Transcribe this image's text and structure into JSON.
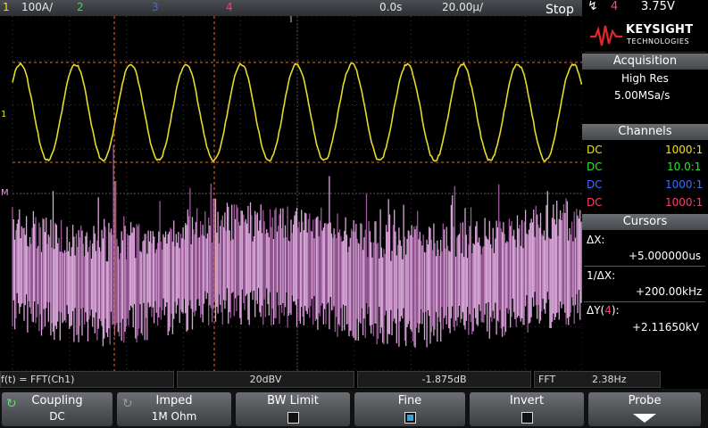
{
  "top_bar": {
    "ch1_scale": "100A/",
    "ch2": "2",
    "ch3": "3",
    "ch4": "4",
    "time_pos": "0.0s",
    "time_scale": "20.00µ/",
    "run_state": "Stop",
    "trigger_channel": "4",
    "trigger_level": "3.75V"
  },
  "brand": {
    "name": "KEYSIGHT",
    "sub": "TECHNOLOGIES"
  },
  "acquisition": {
    "header": "Acquisition",
    "mode": "High Res",
    "rate": "5.00MSa/s"
  },
  "channels": {
    "header": "Channels",
    "items": [
      {
        "coupling": "DC",
        "probe": "1000:1",
        "color": "#f0e400"
      },
      {
        "coupling": "DC",
        "probe": "10.0:1",
        "color": "#34e034"
      },
      {
        "coupling": "DC",
        "probe": "1000:1",
        "color": "#3b6cff"
      },
      {
        "coupling": "DC",
        "probe": "1000:1",
        "color": "#ff3c6e"
      }
    ]
  },
  "cursors": {
    "header": "Cursors",
    "dx_label": "ΔX:",
    "dx_value": "+5.000000us",
    "inv_dx_label": "1/ΔX:",
    "inv_dx_value": "+200.00kHz",
    "dy_label_pre": "ΔY(",
    "dy_ch": "4",
    "dy_label_post": "):",
    "dy_value": "+2.11650kV"
  },
  "status_bar": {
    "math": "f(t) = FFT(Ch1)",
    "vscale": "20dBV",
    "offset": "-1.875dB",
    "fft_label": "FFT",
    "fft_res": "2.38Hz"
  },
  "softkeys": {
    "coupling": {
      "label": "Coupling",
      "value": "DC"
    },
    "imped": {
      "label": "Imped",
      "value": "1M Ohm"
    },
    "bw_limit": {
      "label": "BW Limit",
      "checked": false
    },
    "fine": {
      "label": "Fine",
      "checked": true
    },
    "invert": {
      "label": "Invert",
      "checked": false
    },
    "probe": {
      "label": "Probe"
    }
  },
  "colors": {
    "ch1": "#e6dc26",
    "fft": "#d9a6d9",
    "cursor": "#d8742e"
  }
}
